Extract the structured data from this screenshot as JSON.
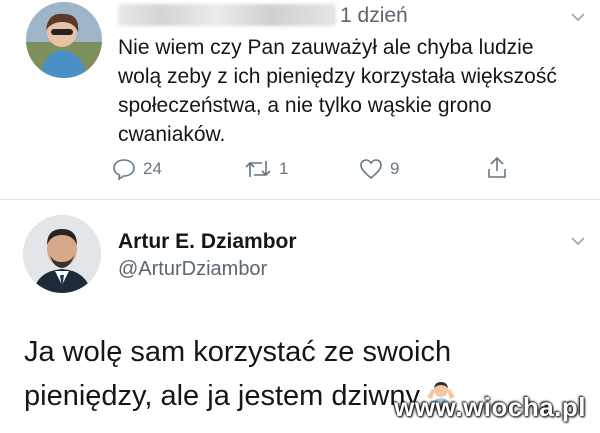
{
  "tweet1": {
    "time": "1 dzień",
    "text": "Nie wiem czy Pan zauważył ale chyba ludzie wolą zeby z ich pieniędzy korzystała większość społeczeństwa, a nie tylko wąskie grono cwaniaków.",
    "replies": "24",
    "retweets": "1",
    "likes": "9",
    "icons": [
      "reply-icon",
      "retweet-icon",
      "like-icon",
      "share-icon",
      "chevron-down-icon"
    ]
  },
  "tweet2": {
    "display_name": "Artur E. Dziambor",
    "handle": "@ArturDziambor",
    "text": "Ja wolę sam korzystać ze swoich pieniędzy, ale ja jestem dziwny",
    "emoji": "man-shrugging-emoji"
  },
  "watermark": "www.wiocha.pl",
  "colors": {
    "text": "#14171a",
    "secondary": "#657786",
    "divider": "#e1e6ea",
    "background": "#ffffff"
  }
}
